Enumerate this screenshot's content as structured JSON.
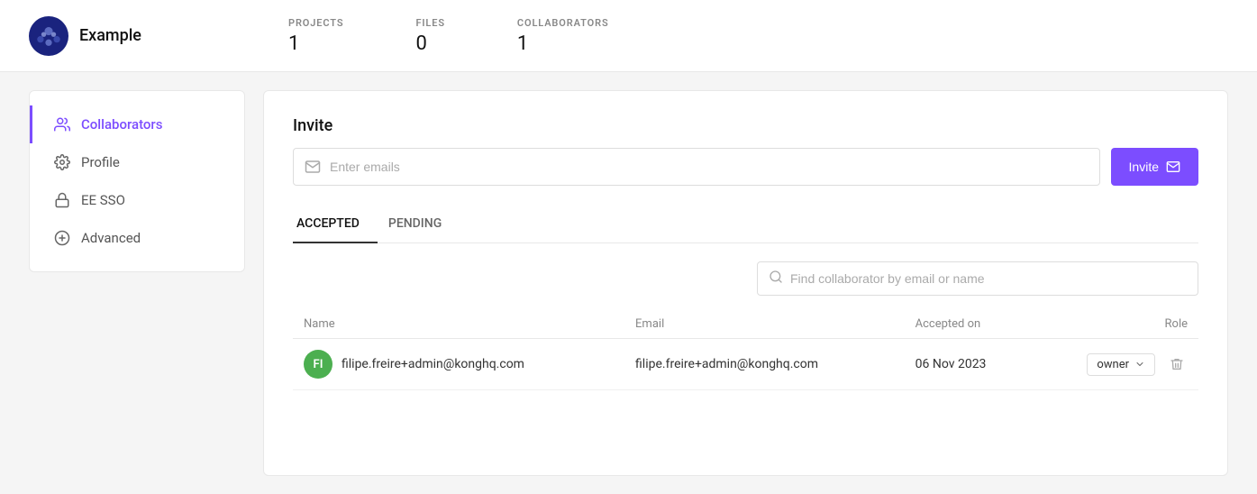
{
  "topbar": {
    "org_name": "Example",
    "stats": [
      {
        "label": "PROJECTS",
        "value": "1"
      },
      {
        "label": "FILES",
        "value": "0"
      },
      {
        "label": "COLLABORATORS",
        "value": "1"
      }
    ]
  },
  "sidebar": {
    "items": [
      {
        "id": "collaborators",
        "label": "Collaborators",
        "active": true
      },
      {
        "id": "profile",
        "label": "Profile",
        "active": false
      },
      {
        "id": "ee-sso",
        "label": "EE SSO",
        "active": false
      },
      {
        "id": "advanced",
        "label": "Advanced",
        "active": false
      }
    ]
  },
  "content": {
    "invite_title": "Invite",
    "invite_placeholder": "Enter emails",
    "invite_btn_label": "Invite",
    "tabs": [
      {
        "id": "accepted",
        "label": "ACCEPTED",
        "active": true
      },
      {
        "id": "pending",
        "label": "PENDING",
        "active": false
      }
    ],
    "search_placeholder": "Find collaborator by email or name",
    "table": {
      "headers": [
        "Name",
        "Email",
        "Accepted on",
        "Role"
      ],
      "rows": [
        {
          "initials": "FI",
          "name": "filipe.freire+admin@konghq.com",
          "email": "filipe.freire+admin@konghq.com",
          "accepted_on": "06 Nov 2023",
          "role": "owner"
        }
      ]
    }
  }
}
